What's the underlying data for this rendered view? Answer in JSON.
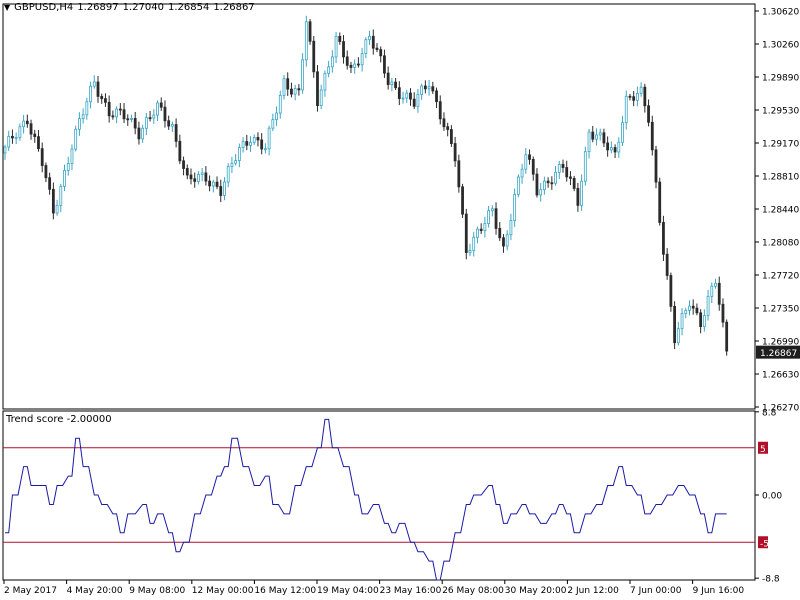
{
  "header": {
    "symbol": "GBPUSD,H4",
    "open": "1.26897",
    "high": "1.27040",
    "low": "1.26854",
    "close": "1.26867",
    "current_price": "1.26867"
  },
  "indicator": {
    "title": "Trend score -2.00000",
    "levels": {
      "upper": 5,
      "lower": -5
    },
    "ticks": [
      "8.8",
      "0.00",
      "-8.8"
    ],
    "level_labels": [
      "5",
      "-5"
    ],
    "level_color": "#b0102a",
    "line_color": "#1a1aa8"
  },
  "colors": {
    "bull": "#3aa6c6",
    "bear": "#2b2b2b",
    "axis": "#000000",
    "price_badge": "#1e1e1e"
  },
  "chart_data": [
    {
      "type": "candlestick",
      "title": "GBPUSD,H4",
      "ylim": [
        1.2627,
        1.3062
      ],
      "yticks": [
        "1.30620",
        "1.30260",
        "1.29890",
        "1.29530",
        "1.29170",
        "1.28810",
        "1.28440",
        "1.28080",
        "1.27720",
        "1.27350",
        "1.26990",
        "1.26630",
        "1.26270"
      ],
      "xticks": [
        "2 May 2017",
        "4 May 20:00",
        "9 May 08:00",
        "12 May 00:00",
        "16 May 12:00",
        "19 May 04:00",
        "23 May 16:00",
        "26 May 08:00",
        "30 May 20:00",
        "2 Jun 12:00",
        "7 Jun 00:00",
        "9 Jun 16:00"
      ],
      "close_path": [
        [
          0,
          1.291
        ],
        [
          6,
          1.2945
        ],
        [
          10,
          1.2895
        ],
        [
          13,
          1.284
        ],
        [
          18,
          1.2915
        ],
        [
          24,
          1.2985
        ],
        [
          28,
          1.295
        ],
        [
          33,
          1.2945
        ],
        [
          36,
          1.293
        ],
        [
          41,
          1.2955
        ],
        [
          45,
          1.2935
        ],
        [
          49,
          1.2875
        ],
        [
          54,
          1.288
        ],
        [
          58,
          1.2865
        ],
        [
          63,
          1.291
        ],
        [
          66,
          1.2925
        ],
        [
          70,
          1.291
        ],
        [
          75,
          1.2985
        ],
        [
          79,
          1.297
        ],
        [
          81,
          1.305
        ],
        [
          84,
          1.2965
        ],
        [
          89,
          1.303
        ],
        [
          93,
          1.2995
        ],
        [
          98,
          1.3035
        ],
        [
          103,
          1.2985
        ],
        [
          107,
          1.297
        ],
        [
          110,
          1.296
        ],
        [
          114,
          1.2985
        ],
        [
          117,
          1.295
        ],
        [
          121,
          1.29
        ],
        [
          124,
          1.28
        ],
        [
          127,
          1.282
        ],
        [
          131,
          1.284
        ],
        [
          134,
          1.28
        ],
        [
          137,
          1.286
        ],
        [
          140,
          1.2905
        ],
        [
          143,
          1.2865
        ],
        [
          147,
          1.288
        ],
        [
          150,
          1.289
        ],
        [
          154,
          1.2855
        ],
        [
          157,
          1.293
        ],
        [
          160,
          1.292
        ],
        [
          164,
          1.2905
        ],
        [
          167,
          1.2965
        ],
        [
          171,
          1.297
        ],
        [
          173,
          1.2945
        ],
        [
          177,
          1.28
        ],
        [
          180,
          1.27
        ],
        [
          184,
          1.2745
        ],
        [
          187,
          1.272
        ],
        [
          191,
          1.2765
        ],
        [
          194,
          1.269
        ]
      ],
      "trend_score": [
        [
          0,
          -4
        ],
        [
          2,
          0
        ],
        [
          5,
          3
        ],
        [
          7,
          1
        ],
        [
          10,
          1
        ],
        [
          12,
          -1
        ],
        [
          14,
          1
        ],
        [
          17,
          2
        ],
        [
          19,
          6
        ],
        [
          21,
          3
        ],
        [
          24,
          0
        ],
        [
          26,
          -1
        ],
        [
          29,
          -2
        ],
        [
          31,
          -4
        ],
        [
          33,
          -2
        ],
        [
          37,
          -1
        ],
        [
          39,
          -3
        ],
        [
          41,
          -2
        ],
        [
          44,
          -4
        ],
        [
          46,
          -6
        ],
        [
          48,
          -5
        ],
        [
          51,
          -2
        ],
        [
          54,
          0
        ],
        [
          57,
          2
        ],
        [
          59,
          3
        ],
        [
          61,
          6
        ],
        [
          64,
          3
        ],
        [
          67,
          1
        ],
        [
          70,
          2
        ],
        [
          72,
          -1
        ],
        [
          75,
          -2
        ],
        [
          78,
          1
        ],
        [
          81,
          3
        ],
        [
          84,
          5
        ],
        [
          86,
          8
        ],
        [
          88,
          5
        ],
        [
          91,
          3
        ],
        [
          94,
          0
        ],
        [
          96,
          -2
        ],
        [
          99,
          -1
        ],
        [
          102,
          -3
        ],
        [
          104,
          -4
        ],
        [
          106,
          -3
        ],
        [
          109,
          -5
        ],
        [
          111,
          -6
        ],
        [
          114,
          -7
        ],
        [
          116,
          -9
        ],
        [
          118,
          -7
        ],
        [
          121,
          -4
        ],
        [
          124,
          -1
        ],
        [
          126,
          0
        ],
        [
          130,
          1
        ],
        [
          132,
          -1
        ],
        [
          134,
          -3
        ],
        [
          136,
          -2
        ],
        [
          139,
          -1
        ],
        [
          141,
          -2
        ],
        [
          144,
          -3
        ],
        [
          147,
          -2
        ],
        [
          149,
          -1
        ],
        [
          151,
          -2
        ],
        [
          153,
          -4
        ],
        [
          156,
          -2
        ],
        [
          159,
          -1
        ],
        [
          162,
          1
        ],
        [
          165,
          3
        ],
        [
          167,
          1
        ],
        [
          170,
          0
        ],
        [
          172,
          -2
        ],
        [
          175,
          -1
        ],
        [
          178,
          0
        ],
        [
          181,
          1
        ],
        [
          184,
          0
        ],
        [
          187,
          -2
        ],
        [
          189,
          -4
        ],
        [
          191,
          -2
        ],
        [
          194,
          -2
        ]
      ]
    }
  ]
}
